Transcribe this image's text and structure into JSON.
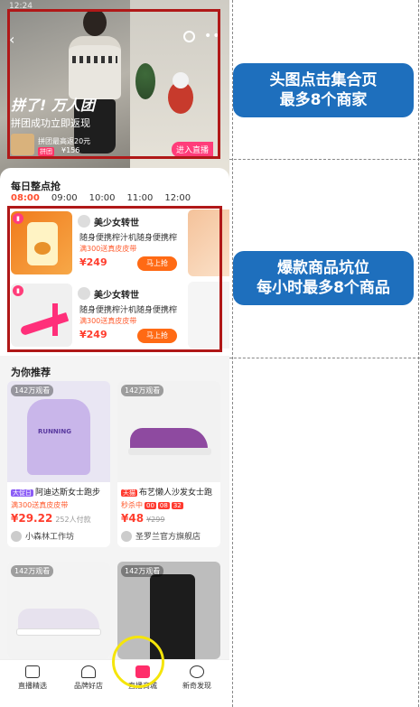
{
  "hero": {
    "status_time": "12:24",
    "title": "拼了! 万人团",
    "subtitle": "拼团成功立即返现",
    "deal_text": "拼团最高返20元",
    "badge": "拼团",
    "price": "¥156",
    "enter_live": "进入直播"
  },
  "flash": {
    "heading": "每日整点抢",
    "times": [
      "08:00",
      "09:00",
      "10:00",
      "11:00",
      "12:00"
    ],
    "cards": [
      {
        "anchor": "美少女转世",
        "desc": "随身便携榨汁机随身便携榨",
        "promo": "满300送真皮皮带",
        "price": "¥249",
        "buy": "马上抢"
      },
      {
        "anchor": "美少女转世",
        "desc": "随身便携榨汁机随身便携榨",
        "promo": "满300送真皮皮带",
        "price": "¥249",
        "buy": "马上抢"
      }
    ]
  },
  "recommend": {
    "title": "为你推荐",
    "products": [
      {
        "viewers": "142万观看",
        "tag": "大促日",
        "title": "阿迪达斯女士跑步",
        "promo": "满300送真皮皮带",
        "price": "¥29.22",
        "extra": "252人付款",
        "shop": "小森林工作坊"
      },
      {
        "viewers": "142万观看",
        "tag": "天猫",
        "title": "布艺懒人沙发女士跑",
        "promo": "秒杀中",
        "timer": [
          "00",
          "08",
          "32"
        ],
        "price": "¥48",
        "extra": "¥299",
        "shop": "圣罗兰官方旗舰店"
      },
      {
        "viewers": "142万观看"
      },
      {
        "viewers": "142万观看"
      }
    ]
  },
  "tabbar": {
    "items": [
      "直播精选",
      "品牌好店",
      "直播商城",
      "新奇发现"
    ]
  },
  "callouts": {
    "top": [
      "头图点击集合页",
      "最多8个商家"
    ],
    "middle": [
      "爆款商品坑位",
      "每小时最多8个商品"
    ]
  },
  "colors": {
    "accent": "#ff3d2d",
    "callout_bg": "#1e6fbd",
    "highlight_box": "#b01818",
    "circle": "#f5e50a"
  }
}
